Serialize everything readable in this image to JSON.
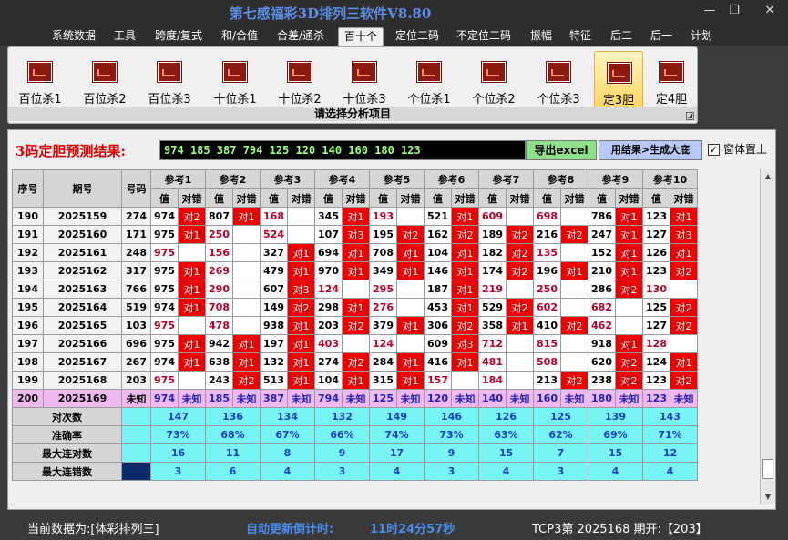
{
  "window": {
    "title": "第七感福彩3D排列三软件V8.80",
    "controls": [
      "—",
      "❐",
      "✕"
    ]
  },
  "menu": [
    "系统数据",
    "工具",
    "跨度/复式",
    "和/合值",
    "合差/通杀",
    "百十个",
    "定位二码",
    "不定位二码",
    "振幅",
    "特征",
    "后二",
    "后一",
    "计划"
  ],
  "active_menu": "百十个",
  "ribbon": {
    "buttons": [
      {
        "label": "百位杀1",
        "icon": "chart-icon"
      },
      {
        "label": "百位杀2",
        "icon": "chart-icon"
      },
      {
        "label": "百位杀3",
        "icon": "chart-icon"
      },
      {
        "label": "十位杀1",
        "icon": "chart-icon"
      },
      {
        "label": "十位杀2",
        "icon": "chart-icon"
      },
      {
        "label": "十位杀3",
        "icon": "chart-icon"
      },
      {
        "label": "个位杀1",
        "icon": "chart-icon"
      },
      {
        "label": "个位杀2",
        "icon": "chart-icon"
      },
      {
        "label": "个位杀3",
        "icon": "chart-icon"
      },
      {
        "label": "定3胆",
        "icon": "chart-icon",
        "active": true
      },
      {
        "label": "定4胆",
        "icon": "chart-icon"
      }
    ],
    "caption": "请选择分析项目"
  },
  "prediction": {
    "label": "3码定胆预测结果:",
    "value": "974 185 387 794 125 120 140 160 180 123",
    "export_label": "导出excel",
    "bigbase_label": "用结果>生成大底",
    "ontop_label": "窗体置上",
    "ontop_checked": true
  },
  "table": {
    "headers": {
      "seq": "序号",
      "period": "期号",
      "number": "号码",
      "value": "值",
      "hit": "对错",
      "refs": [
        "参考1",
        "参考2",
        "参考3",
        "参考4",
        "参考5",
        "参考6",
        "参考7",
        "参考8",
        "参考9",
        "参考10"
      ]
    },
    "rows": [
      {
        "seq": "190",
        "period": "2025159",
        "number": "274",
        "refs": [
          [
            "974",
            "对2"
          ],
          [
            "807",
            "对1"
          ],
          [
            "168",
            ""
          ],
          [
            "345",
            "对1"
          ],
          [
            "193",
            ""
          ],
          [
            "521",
            "对1"
          ],
          [
            "609",
            ""
          ],
          [
            "698",
            ""
          ],
          [
            "786",
            "对1"
          ],
          [
            "123",
            "对1"
          ]
        ]
      },
      {
        "seq": "191",
        "period": "2025160",
        "number": "171",
        "refs": [
          [
            "975",
            "对1"
          ],
          [
            "250",
            ""
          ],
          [
            "524",
            ""
          ],
          [
            "107",
            "对3"
          ],
          [
            "195",
            "对2"
          ],
          [
            "162",
            "对2"
          ],
          [
            "189",
            "对2"
          ],
          [
            "216",
            "对2"
          ],
          [
            "247",
            "对1"
          ],
          [
            "127",
            "对3"
          ]
        ]
      },
      {
        "seq": "192",
        "period": "2025161",
        "number": "248",
        "refs": [
          [
            "975",
            ""
          ],
          [
            "156",
            ""
          ],
          [
            "327",
            "对1"
          ],
          [
            "694",
            "对1"
          ],
          [
            "708",
            "对1"
          ],
          [
            "104",
            "对1"
          ],
          [
            "182",
            "对2"
          ],
          [
            "135",
            ""
          ],
          [
            "152",
            "对1"
          ],
          [
            "126",
            "对1"
          ]
        ]
      },
      {
        "seq": "193",
        "period": "2025162",
        "number": "317",
        "refs": [
          [
            "975",
            "对1"
          ],
          [
            "269",
            ""
          ],
          [
            "479",
            "对1"
          ],
          [
            "970",
            "对1"
          ],
          [
            "349",
            "对1"
          ],
          [
            "146",
            "对1"
          ],
          [
            "174",
            "对2"
          ],
          [
            "196",
            "对1"
          ],
          [
            "210",
            "对1"
          ],
          [
            "123",
            "对2"
          ]
        ]
      },
      {
        "seq": "194",
        "period": "2025163",
        "number": "766",
        "refs": [
          [
            "975",
            "对1"
          ],
          [
            "290",
            ""
          ],
          [
            "607",
            "对3"
          ],
          [
            "124",
            ""
          ],
          [
            "295",
            ""
          ],
          [
            "187",
            "对1"
          ],
          [
            "219",
            ""
          ],
          [
            "250",
            ""
          ],
          [
            "286",
            "对2"
          ],
          [
            "130",
            ""
          ]
        ]
      },
      {
        "seq": "195",
        "period": "2025164",
        "number": "519",
        "refs": [
          [
            "974",
            "对1"
          ],
          [
            "708",
            ""
          ],
          [
            "149",
            "对2"
          ],
          [
            "298",
            "对1"
          ],
          [
            "276",
            ""
          ],
          [
            "453",
            "对1"
          ],
          [
            "529",
            "对2"
          ],
          [
            "602",
            ""
          ],
          [
            "682",
            ""
          ],
          [
            "125",
            "对2"
          ]
        ]
      },
      {
        "seq": "196",
        "period": "2025165",
        "number": "103",
        "refs": [
          [
            "975",
            ""
          ],
          [
            "478",
            ""
          ],
          [
            "938",
            "对1"
          ],
          [
            "203",
            "对2"
          ],
          [
            "379",
            "对1"
          ],
          [
            "306",
            "对2"
          ],
          [
            "358",
            "对1"
          ],
          [
            "410",
            "对2"
          ],
          [
            "462",
            ""
          ],
          [
            "127",
            "对2"
          ]
        ]
      },
      {
        "seq": "197",
        "period": "2025166",
        "number": "696",
        "refs": [
          [
            "975",
            "对1"
          ],
          [
            "942",
            "对1"
          ],
          [
            "197",
            "对1"
          ],
          [
            "403",
            ""
          ],
          [
            "124",
            ""
          ],
          [
            "609",
            "对3"
          ],
          [
            "712",
            ""
          ],
          [
            "815",
            ""
          ],
          [
            "918",
            "对1"
          ],
          [
            "128",
            ""
          ]
        ]
      },
      {
        "seq": "198",
        "period": "2025167",
        "number": "267",
        "refs": [
          [
            "974",
            "对1"
          ],
          [
            "638",
            "对1"
          ],
          [
            "132",
            "对1"
          ],
          [
            "274",
            "对2"
          ],
          [
            "284",
            "对1"
          ],
          [
            "416",
            "对1"
          ],
          [
            "481",
            ""
          ],
          [
            "508",
            ""
          ],
          [
            "620",
            "对2"
          ],
          [
            "124",
            "对1"
          ]
        ]
      },
      {
        "seq": "199",
        "period": "2025168",
        "number": "203",
        "refs": [
          [
            "975",
            ""
          ],
          [
            "243",
            "对2"
          ],
          [
            "513",
            "对1"
          ],
          [
            "104",
            "对1"
          ],
          [
            "315",
            "对1"
          ],
          [
            "157",
            ""
          ],
          [
            "184",
            ""
          ],
          [
            "213",
            "对2"
          ],
          [
            "238",
            "对2"
          ],
          [
            "123",
            "对2"
          ]
        ]
      }
    ],
    "prediction_row": {
      "seq": "200",
      "period": "2025169",
      "number": "未知",
      "values": [
        "974",
        "185",
        "387",
        "794",
        "125",
        "120",
        "140",
        "160",
        "180",
        "123"
      ],
      "unknown_label": "未知"
    },
    "stats": [
      {
        "label": "对次数",
        "values": [
          "147",
          "136",
          "134",
          "132",
          "149",
          "146",
          "126",
          "125",
          "139",
          "143"
        ]
      },
      {
        "label": "准确率",
        "values": [
          "73%",
          "68%",
          "67%",
          "66%",
          "74%",
          "73%",
          "63%",
          "62%",
          "69%",
          "71%"
        ]
      },
      {
        "label": "最大连对数",
        "values": [
          "16",
          "11",
          "8",
          "9",
          "17",
          "9",
          "15",
          "7",
          "15",
          "12"
        ]
      },
      {
        "label": "最大连错数",
        "values": [
          "3",
          "6",
          "4",
          "3",
          "4",
          "3",
          "4",
          "3",
          "4",
          "4"
        ]
      }
    ]
  },
  "status": {
    "data_source": "当前数据为:[体彩排列三]",
    "countdown_label": "自动更新倒计时:",
    "countdown_value": "11时24分57秒",
    "latest": "TCP3第 2025168 期开:【203】"
  },
  "colors": {
    "hit": "#ee0000",
    "miss_value": "#c0002a",
    "prediction_row": "#f0b8f0",
    "stats_row": "#78f4f4",
    "title": "#5a8fe8",
    "predict_label": "#e00000",
    "predict_text": "#9cff7a",
    "status_blue": "#4a8df0"
  }
}
